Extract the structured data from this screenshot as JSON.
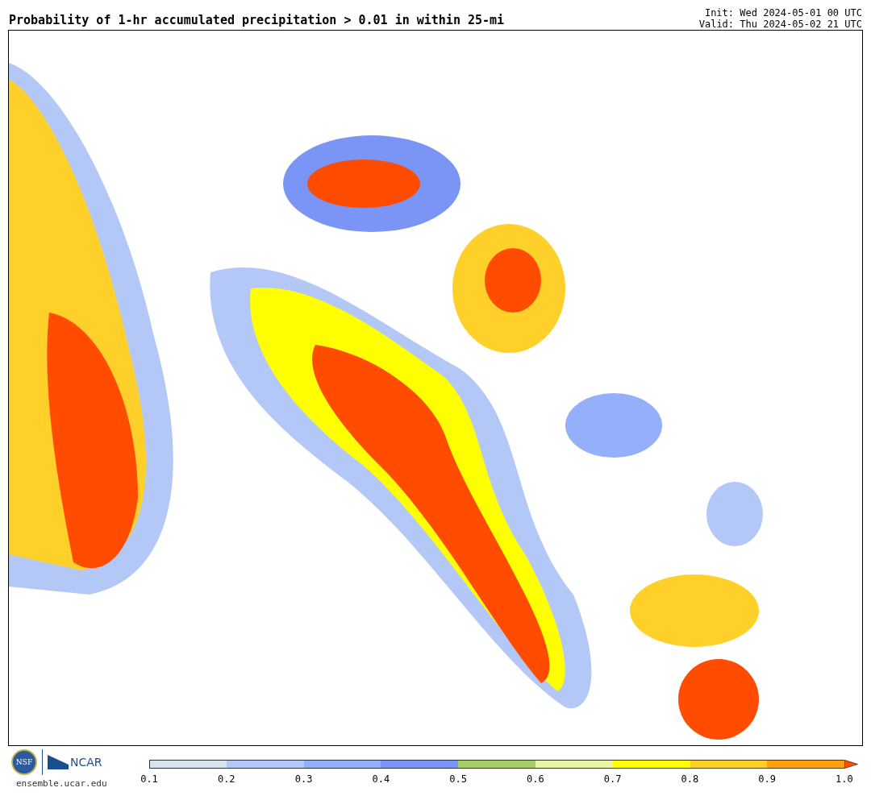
{
  "title": "Probability of 1-hr accumulated precipitation > 0.01 in within 25-mi",
  "init": "Init: Wed 2024-05-01 00 UTC",
  "valid": "Valid: Thu 2024-05-02 21 UTC",
  "logos": {
    "nsf": "NSF",
    "ncar": "NCAR",
    "url": "ensemble.ucar.edu"
  },
  "colorbar": {
    "bins": [
      {
        "kind": "box",
        "color": "#d9e3ef"
      },
      {
        "kind": "box",
        "color": "#b4c8f8"
      },
      {
        "kind": "box",
        "color": "#94b0fa"
      },
      {
        "kind": "box",
        "color": "#7a95f5"
      },
      {
        "kind": "box",
        "color": "#a7cd6a"
      },
      {
        "kind": "box",
        "color": "#e6f5a8"
      },
      {
        "kind": "box",
        "color": "#ffff00"
      },
      {
        "kind": "box",
        "color": "#ffd02a"
      },
      {
        "kind": "box",
        "color": "#ffa010"
      },
      {
        "kind": "arrow",
        "color": "#ff4c00"
      }
    ],
    "ticks": [
      "0.1",
      "0.2",
      "0.3",
      "0.4",
      "0.5",
      "0.6",
      "0.7",
      "0.8",
      "0.9",
      "1.0"
    ]
  }
}
